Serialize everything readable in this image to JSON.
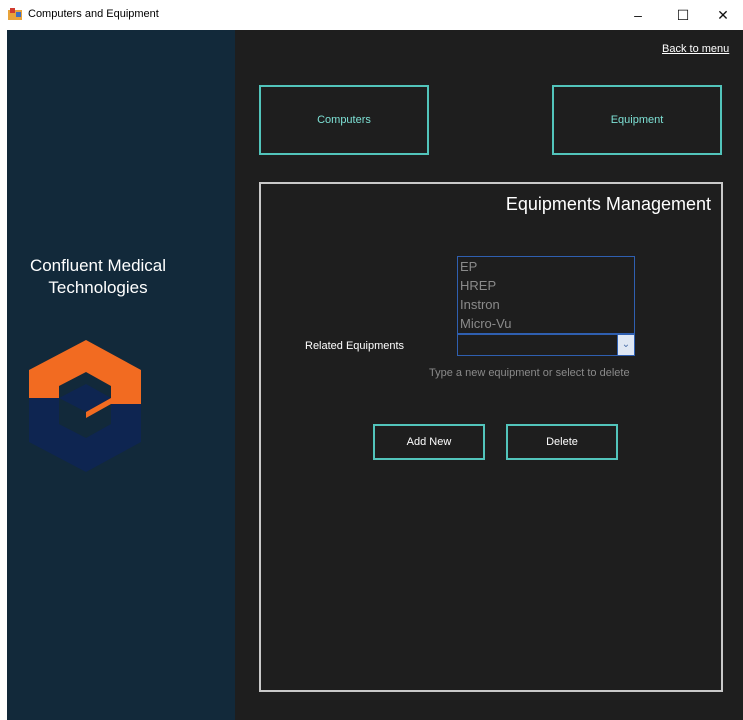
{
  "window": {
    "title": "Computers and Equipment",
    "minimize": "–",
    "maximize": "☐",
    "close": "✕"
  },
  "sidebar": {
    "company_line1": "Confluent Medical",
    "company_line2": "Technologies",
    "logo_colors": {
      "orange": "#f26b21",
      "navy": "#0e2551"
    }
  },
  "header": {
    "back_link": "Back to menu",
    "nav": {
      "computers": "Computers",
      "equipment": "Equipment"
    }
  },
  "panel": {
    "title": "Equipments Management",
    "equipment_list": [
      "EP",
      "HREP",
      "Instron",
      "Micro-Vu"
    ],
    "related_label": "Related Equipments",
    "combo_value": "",
    "combo_arrow": "⌄",
    "hint": "Type a new equipment or select to delete",
    "add_button": "Add New",
    "delete_button": "Delete"
  },
  "colors": {
    "accent": "#52c4bb",
    "sidebar_bg": "#12293a",
    "main_bg": "#1e1e1e"
  }
}
